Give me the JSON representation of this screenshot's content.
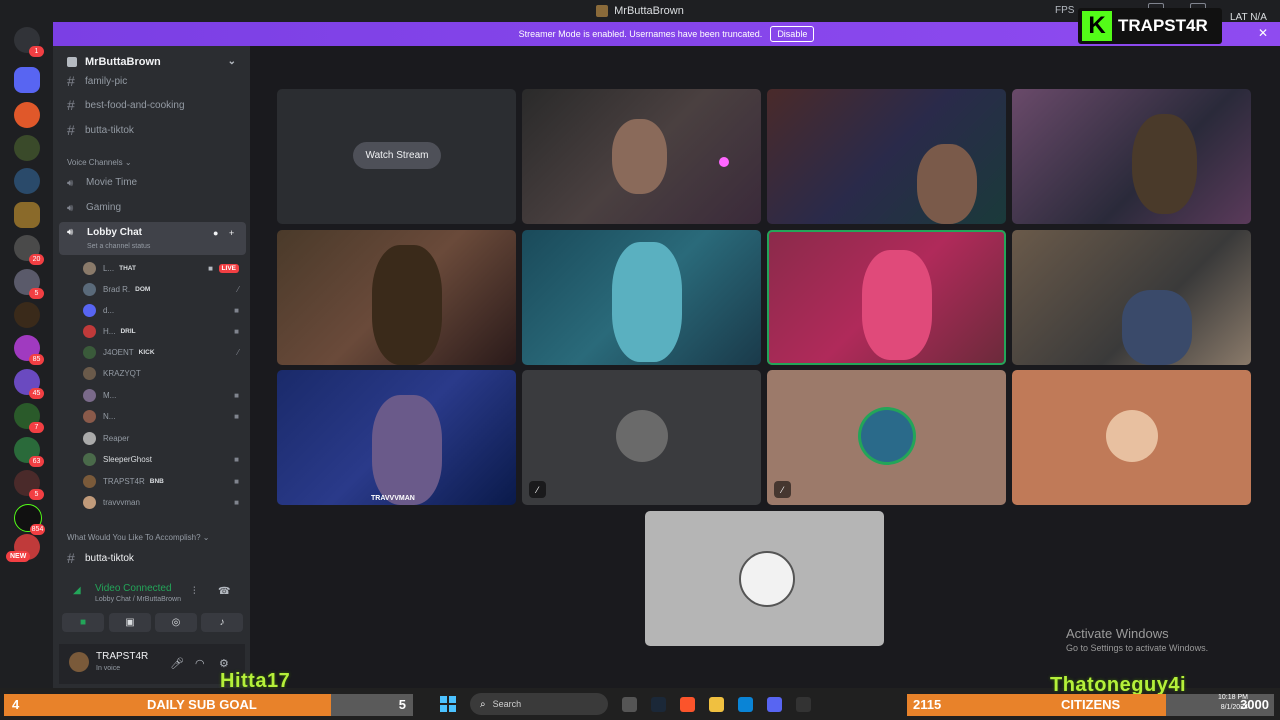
{
  "window": {
    "title": "MrButtaBrown",
    "fps_label": "FPS",
    "lat_label": "LAT",
    "lat_value": "N/A"
  },
  "banner": {
    "text": "Streamer Mode is enabled. Usernames have been truncated.",
    "disable_label": "Disable",
    "close_icon": "close-icon"
  },
  "kick_overlay": {
    "logo_letter": "K",
    "name": "TRAPST4R",
    "brand_color": "#53fc18"
  },
  "server_rail": {
    "badges": [
      "1",
      "20",
      "5",
      "85",
      "45",
      "7",
      "63",
      "5",
      "854"
    ],
    "new_label": "NEW"
  },
  "sidebar": {
    "server_name": "MrButtaBrown",
    "text_channels_top": [
      "family-pic",
      "best-food-and-cooking",
      "butta-tiktok"
    ],
    "voice_category": "Voice Channels",
    "voice_channels": [
      "Movie Time",
      "Gaming"
    ],
    "active_voice": {
      "name": "Lobby Chat",
      "status": "Set a channel status"
    },
    "members": [
      {
        "name": "L...",
        "tag": "THAT",
        "live": "LIVE"
      },
      {
        "name": "Brad R.",
        "tag": "DOM"
      },
      {
        "name": "d...",
        "tag": ""
      },
      {
        "name": "H...",
        "tag": "DRIL"
      },
      {
        "name": "J4OENT",
        "tag": "KICK"
      },
      {
        "name": "KRAZYQT",
        "tag": ""
      },
      {
        "name": "M...",
        "tag": ""
      },
      {
        "name": "N...",
        "tag": ""
      },
      {
        "name": "Reaper",
        "tag": ""
      },
      {
        "name": "SleeperGhost",
        "tag": ""
      },
      {
        "name": "TRAPST4R",
        "tag": "BNB"
      },
      {
        "name": "travvvman",
        "tag": ""
      }
    ],
    "category_bottom": "What Would You Like To Accomplish?",
    "text_channel_bottom": "butta-tiktok"
  },
  "voice_panel": {
    "status": "Video Connected",
    "location": "Lobby Chat / MrButtaBrown"
  },
  "user_panel": {
    "username": "TRAPST4R",
    "status": "In voice"
  },
  "stage": {
    "watch_stream_label": "Watch Stream",
    "tile_label_travv": "TRAVVVMAN"
  },
  "watermark": {
    "title": "Activate Windows",
    "subtitle": "Go to Settings to activate Windows."
  },
  "overlays": {
    "left_name": "Hitta17",
    "right_name": "Thatoneguy4i",
    "sub_goal": {
      "current": "4",
      "label": "DAILY SUB GOAL",
      "target": "5",
      "progress": 0.8
    },
    "citizens": {
      "current": "2115",
      "label": "CITIZENS",
      "target": "3000",
      "progress": 0.705
    }
  },
  "taskbar": {
    "search_placeholder": "Search",
    "time": "10:18 PM",
    "date": "8/1/2024"
  },
  "colors": {
    "discord_bg": "#1e1f22",
    "sidebar_bg": "#2b2d31",
    "banner": "#8f4bf0",
    "speaking": "#23a559",
    "live": "#f23f43",
    "goal_fill": "#e8822a"
  }
}
